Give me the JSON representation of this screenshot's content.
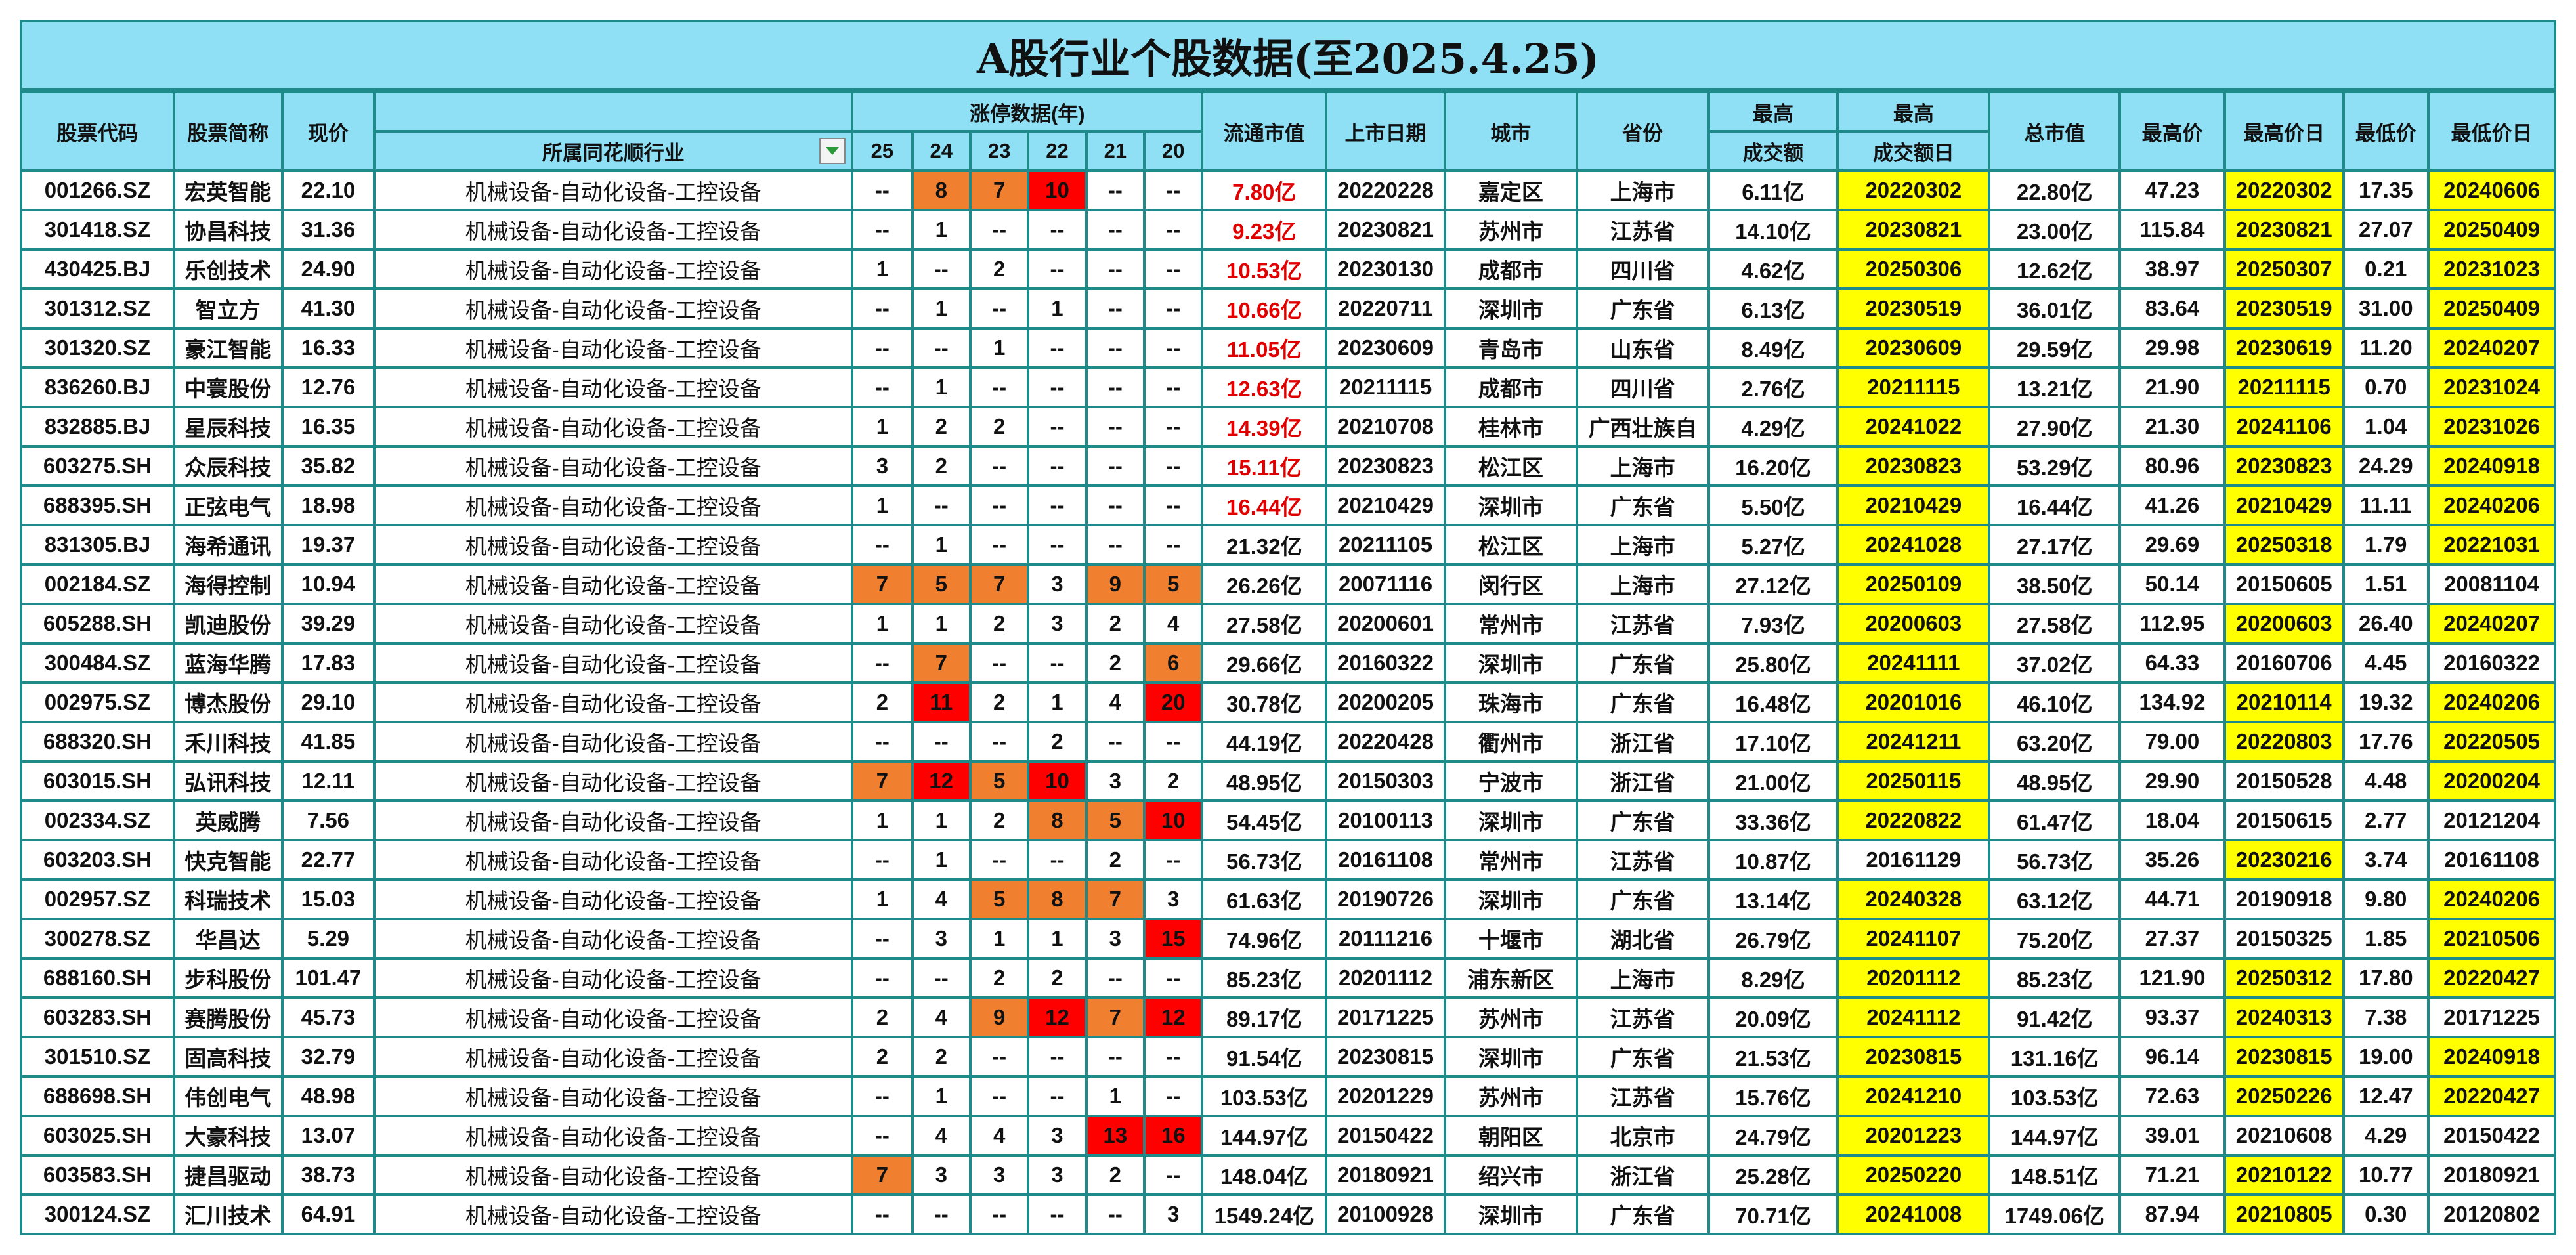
{
  "title": "A股行业个股数据(至2025.4.25)",
  "headers": {
    "code": "股票代码",
    "name": "股票简称",
    "price": "现价",
    "industry": "所属同花顺行业",
    "limit_group": "涨停数据(年)",
    "years": [
      "25",
      "24",
      "23",
      "22",
      "21",
      "20"
    ],
    "float_cap": "流通市值",
    "list_date": "上市日期",
    "city": "城市",
    "province": "省份",
    "max_turnover_top": "最高",
    "max_turnover_bottom": "成交额",
    "max_turnover_day_top": "最高",
    "max_turnover_day_bottom": "成交额日",
    "total_cap": "总市值",
    "high_price": "最高价",
    "high_day": "最高价日",
    "low_price": "最低价",
    "low_day": "最低价日"
  },
  "colors": {
    "header_bg": "#8fe0f5",
    "border": "#1f8a8a",
    "highlight_yellow": "#ffff00",
    "limit_orange": "#f08030",
    "limit_red": "#ff0000",
    "value_red": "#e00000"
  },
  "icons": {
    "filter": "dropdown-filter-icon"
  },
  "rows": [
    {
      "code": "001266.SZ",
      "name": "宏英智能",
      "price": "22.10",
      "industry": "机械设备-自动化设备-工控设备",
      "limits": [
        "--",
        "8",
        "7",
        "10",
        "--",
        "--"
      ],
      "float_cap": "7.80亿",
      "list_date": "20220228",
      "city": "嘉定区",
      "province": "上海市",
      "max_turnover": "6.11亿",
      "max_turnover_day": "20220302",
      "total_cap": "22.80亿",
      "high_price": "47.23",
      "high_day": "20220302",
      "low_price": "17.35",
      "low_day": "20240606"
    },
    {
      "code": "301418.SZ",
      "name": "协昌科技",
      "price": "31.36",
      "industry": "机械设备-自动化设备-工控设备",
      "limits": [
        "--",
        "1",
        "--",
        "--",
        "--",
        "--"
      ],
      "float_cap": "9.23亿",
      "list_date": "20230821",
      "city": "苏州市",
      "province": "江苏省",
      "max_turnover": "14.10亿",
      "max_turnover_day": "20230821",
      "total_cap": "23.00亿",
      "high_price": "115.84",
      "high_day": "20230821",
      "low_price": "27.07",
      "low_day": "20250409"
    },
    {
      "code": "430425.BJ",
      "name": "乐创技术",
      "price": "24.90",
      "industry": "机械设备-自动化设备-工控设备",
      "limits": [
        "1",
        "--",
        "2",
        "--",
        "--",
        "--"
      ],
      "float_cap": "10.53亿",
      "list_date": "20230130",
      "city": "成都市",
      "province": "四川省",
      "max_turnover": "4.62亿",
      "max_turnover_day": "20250306",
      "total_cap": "12.62亿",
      "high_price": "38.97",
      "high_day": "20250307",
      "low_price": "0.21",
      "low_day": "20231023"
    },
    {
      "code": "301312.SZ",
      "name": "智立方",
      "price": "41.30",
      "industry": "机械设备-自动化设备-工控设备",
      "limits": [
        "--",
        "1",
        "--",
        "1",
        "--",
        "--"
      ],
      "float_cap": "10.66亿",
      "list_date": "20220711",
      "city": "深圳市",
      "province": "广东省",
      "max_turnover": "6.13亿",
      "max_turnover_day": "20230519",
      "total_cap": "36.01亿",
      "high_price": "83.64",
      "high_day": "20230519",
      "low_price": "31.00",
      "low_day": "20250409"
    },
    {
      "code": "301320.SZ",
      "name": "豪江智能",
      "price": "16.33",
      "industry": "机械设备-自动化设备-工控设备",
      "limits": [
        "--",
        "--",
        "1",
        "--",
        "--",
        "--"
      ],
      "float_cap": "11.05亿",
      "list_date": "20230609",
      "city": "青岛市",
      "province": "山东省",
      "max_turnover": "8.49亿",
      "max_turnover_day": "20230609",
      "total_cap": "29.59亿",
      "high_price": "29.98",
      "high_day": "20230619",
      "low_price": "11.20",
      "low_day": "20240207"
    },
    {
      "code": "836260.BJ",
      "name": "中寰股份",
      "price": "12.76",
      "industry": "机械设备-自动化设备-工控设备",
      "limits": [
        "--",
        "1",
        "--",
        "--",
        "--",
        "--"
      ],
      "float_cap": "12.63亿",
      "list_date": "20211115",
      "city": "成都市",
      "province": "四川省",
      "max_turnover": "2.76亿",
      "max_turnover_day": "20211115",
      "total_cap": "13.21亿",
      "high_price": "21.90",
      "high_day": "20211115",
      "low_price": "0.70",
      "low_day": "20231024"
    },
    {
      "code": "832885.BJ",
      "name": "星辰科技",
      "price": "16.35",
      "industry": "机械设备-自动化设备-工控设备",
      "limits": [
        "1",
        "2",
        "2",
        "--",
        "--",
        "--"
      ],
      "float_cap": "14.39亿",
      "list_date": "20210708",
      "city": "桂林市",
      "province": "广西壮族自",
      "max_turnover": "4.29亿",
      "max_turnover_day": "20241022",
      "total_cap": "27.90亿",
      "high_price": "21.30",
      "high_day": "20241106",
      "low_price": "1.04",
      "low_day": "20231026"
    },
    {
      "code": "603275.SH",
      "name": "众辰科技",
      "price": "35.82",
      "industry": "机械设备-自动化设备-工控设备",
      "limits": [
        "3",
        "2",
        "--",
        "--",
        "--",
        "--"
      ],
      "float_cap": "15.11亿",
      "list_date": "20230823",
      "city": "松江区",
      "province": "上海市",
      "max_turnover": "16.20亿",
      "max_turnover_day": "20230823",
      "total_cap": "53.29亿",
      "high_price": "80.96",
      "high_day": "20230823",
      "low_price": "24.29",
      "low_day": "20240918"
    },
    {
      "code": "688395.SH",
      "name": "正弦电气",
      "price": "18.98",
      "industry": "机械设备-自动化设备-工控设备",
      "limits": [
        "1",
        "--",
        "--",
        "--",
        "--",
        "--"
      ],
      "float_cap": "16.44亿",
      "list_date": "20210429",
      "city": "深圳市",
      "province": "广东省",
      "max_turnover": "5.50亿",
      "max_turnover_day": "20210429",
      "total_cap": "16.44亿",
      "high_price": "41.26",
      "high_day": "20210429",
      "low_price": "11.11",
      "low_day": "20240206"
    },
    {
      "code": "831305.BJ",
      "name": "海希通讯",
      "price": "19.37",
      "industry": "机械设备-自动化设备-工控设备",
      "limits": [
        "--",
        "1",
        "--",
        "--",
        "--",
        "--"
      ],
      "float_cap": "21.32亿",
      "list_date": "20211105",
      "city": "松江区",
      "province": "上海市",
      "max_turnover": "5.27亿",
      "max_turnover_day": "20241028",
      "total_cap": "27.17亿",
      "high_price": "29.69",
      "high_day": "20250318",
      "low_price": "1.79",
      "low_day": "20221031"
    },
    {
      "code": "002184.SZ",
      "name": "海得控制",
      "price": "10.94",
      "industry": "机械设备-自动化设备-工控设备",
      "limits": [
        "7",
        "5",
        "7",
        "3",
        "9",
        "5"
      ],
      "float_cap": "26.26亿",
      "list_date": "20071116",
      "city": "闵行区",
      "province": "上海市",
      "max_turnover": "27.12亿",
      "max_turnover_day": "20250109",
      "total_cap": "38.50亿",
      "high_price": "50.14",
      "high_day": "20150605",
      "low_price": "1.51",
      "low_day": "20081104"
    },
    {
      "code": "605288.SH",
      "name": "凯迪股份",
      "price": "39.29",
      "industry": "机械设备-自动化设备-工控设备",
      "limits": [
        "1",
        "1",
        "2",
        "3",
        "2",
        "4"
      ],
      "float_cap": "27.58亿",
      "list_date": "20200601",
      "city": "常州市",
      "province": "江苏省",
      "max_turnover": "7.93亿",
      "max_turnover_day": "20200603",
      "total_cap": "27.58亿",
      "high_price": "112.95",
      "high_day": "20200603",
      "low_price": "26.40",
      "low_day": "20240207"
    },
    {
      "code": "300484.SZ",
      "name": "蓝海华腾",
      "price": "17.83",
      "industry": "机械设备-自动化设备-工控设备",
      "limits": [
        "--",
        "7",
        "--",
        "--",
        "2",
        "6"
      ],
      "float_cap": "29.66亿",
      "list_date": "20160322",
      "city": "深圳市",
      "province": "广东省",
      "max_turnover": "25.80亿",
      "max_turnover_day": "20241111",
      "total_cap": "37.02亿",
      "high_price": "64.33",
      "high_day": "20160706",
      "low_price": "4.45",
      "low_day": "20160322"
    },
    {
      "code": "002975.SZ",
      "name": "博杰股份",
      "price": "29.10",
      "industry": "机械设备-自动化设备-工控设备",
      "limits": [
        "2",
        "11",
        "2",
        "1",
        "4",
        "20"
      ],
      "float_cap": "30.78亿",
      "list_date": "20200205",
      "city": "珠海市",
      "province": "广东省",
      "max_turnover": "16.48亿",
      "max_turnover_day": "20201016",
      "total_cap": "46.10亿",
      "high_price": "134.92",
      "high_day": "20210114",
      "low_price": "19.32",
      "low_day": "20240206"
    },
    {
      "code": "688320.SH",
      "name": "禾川科技",
      "price": "41.85",
      "industry": "机械设备-自动化设备-工控设备",
      "limits": [
        "--",
        "--",
        "--",
        "2",
        "--",
        "--"
      ],
      "float_cap": "44.19亿",
      "list_date": "20220428",
      "city": "衢州市",
      "province": "浙江省",
      "max_turnover": "17.10亿",
      "max_turnover_day": "20241211",
      "total_cap": "63.20亿",
      "high_price": "79.00",
      "high_day": "20220803",
      "low_price": "17.76",
      "low_day": "20220505"
    },
    {
      "code": "603015.SH",
      "name": "弘讯科技",
      "price": "12.11",
      "industry": "机械设备-自动化设备-工控设备",
      "limits": [
        "7",
        "12",
        "5",
        "10",
        "3",
        "2"
      ],
      "float_cap": "48.95亿",
      "list_date": "20150303",
      "city": "宁波市",
      "province": "浙江省",
      "max_turnover": "21.00亿",
      "max_turnover_day": "20250115",
      "total_cap": "48.95亿",
      "high_price": "29.90",
      "high_day": "20150528",
      "low_price": "4.48",
      "low_day": "20200204"
    },
    {
      "code": "002334.SZ",
      "name": "英威腾",
      "price": "7.56",
      "industry": "机械设备-自动化设备-工控设备",
      "limits": [
        "1",
        "1",
        "2",
        "8",
        "5",
        "10"
      ],
      "float_cap": "54.45亿",
      "list_date": "20100113",
      "city": "深圳市",
      "province": "广东省",
      "max_turnover": "33.36亿",
      "max_turnover_day": "20220822",
      "total_cap": "61.47亿",
      "high_price": "18.04",
      "high_day": "20150615",
      "low_price": "2.77",
      "low_day": "20121204"
    },
    {
      "code": "603203.SH",
      "name": "快克智能",
      "price": "22.77",
      "industry": "机械设备-自动化设备-工控设备",
      "limits": [
        "--",
        "1",
        "--",
        "--",
        "2",
        "--"
      ],
      "float_cap": "56.73亿",
      "list_date": "20161108",
      "city": "常州市",
      "province": "江苏省",
      "max_turnover": "10.87亿",
      "max_turnover_day": "20161129",
      "total_cap": "56.73亿",
      "high_price": "35.26",
      "high_day": "20230216",
      "low_price": "3.74",
      "low_day": "20161108"
    },
    {
      "code": "002957.SZ",
      "name": "科瑞技术",
      "price": "15.03",
      "industry": "机械设备-自动化设备-工控设备",
      "limits": [
        "1",
        "4",
        "5",
        "8",
        "7",
        "3"
      ],
      "float_cap": "61.63亿",
      "list_date": "20190726",
      "city": "深圳市",
      "province": "广东省",
      "max_turnover": "13.14亿",
      "max_turnover_day": "20240328",
      "total_cap": "63.12亿",
      "high_price": "44.71",
      "high_day": "20190918",
      "low_price": "9.80",
      "low_day": "20240206"
    },
    {
      "code": "300278.SZ",
      "name": "华昌达",
      "price": "5.29",
      "industry": "机械设备-自动化设备-工控设备",
      "limits": [
        "--",
        "3",
        "1",
        "1",
        "3",
        "15"
      ],
      "float_cap": "74.96亿",
      "list_date": "20111216",
      "city": "十堰市",
      "province": "湖北省",
      "max_turnover": "26.79亿",
      "max_turnover_day": "20241107",
      "total_cap": "75.20亿",
      "high_price": "27.37",
      "high_day": "20150325",
      "low_price": "1.85",
      "low_day": "20210506"
    },
    {
      "code": "688160.SH",
      "name": "步科股份",
      "price": "101.47",
      "industry": "机械设备-自动化设备-工控设备",
      "limits": [
        "--",
        "--",
        "2",
        "2",
        "--",
        "--"
      ],
      "float_cap": "85.23亿",
      "list_date": "20201112",
      "city": "浦东新区",
      "province": "上海市",
      "max_turnover": "8.29亿",
      "max_turnover_day": "20201112",
      "total_cap": "85.23亿",
      "high_price": "121.90",
      "high_day": "20250312",
      "low_price": "17.80",
      "low_day": "20220427"
    },
    {
      "code": "603283.SH",
      "name": "赛腾股份",
      "price": "45.73",
      "industry": "机械设备-自动化设备-工控设备",
      "limits": [
        "2",
        "4",
        "9",
        "12",
        "7",
        "12"
      ],
      "float_cap": "89.17亿",
      "list_date": "20171225",
      "city": "苏州市",
      "province": "江苏省",
      "max_turnover": "20.09亿",
      "max_turnover_day": "20241112",
      "total_cap": "91.42亿",
      "high_price": "93.37",
      "high_day": "20240313",
      "low_price": "7.38",
      "low_day": "20171225"
    },
    {
      "code": "301510.SZ",
      "name": "固高科技",
      "price": "32.79",
      "industry": "机械设备-自动化设备-工控设备",
      "limits": [
        "2",
        "2",
        "--",
        "--",
        "--",
        "--"
      ],
      "float_cap": "91.54亿",
      "list_date": "20230815",
      "city": "深圳市",
      "province": "广东省",
      "max_turnover": "21.53亿",
      "max_turnover_day": "20230815",
      "total_cap": "131.16亿",
      "high_price": "96.14",
      "high_day": "20230815",
      "low_price": "19.00",
      "low_day": "20240918"
    },
    {
      "code": "688698.SH",
      "name": "伟创电气",
      "price": "48.98",
      "industry": "机械设备-自动化设备-工控设备",
      "limits": [
        "--",
        "1",
        "--",
        "--",
        "1",
        "--"
      ],
      "float_cap": "103.53亿",
      "list_date": "20201229",
      "city": "苏州市",
      "province": "江苏省",
      "max_turnover": "15.76亿",
      "max_turnover_day": "20241210",
      "total_cap": "103.53亿",
      "high_price": "72.63",
      "high_day": "20250226",
      "low_price": "12.47",
      "low_day": "20220427"
    },
    {
      "code": "603025.SH",
      "name": "大豪科技",
      "price": "13.07",
      "industry": "机械设备-自动化设备-工控设备",
      "limits": [
        "--",
        "4",
        "4",
        "3",
        "13",
        "16"
      ],
      "float_cap": "144.97亿",
      "list_date": "20150422",
      "city": "朝阳区",
      "province": "北京市",
      "max_turnover": "24.79亿",
      "max_turnover_day": "20201223",
      "total_cap": "144.97亿",
      "high_price": "39.01",
      "high_day": "20210608",
      "low_price": "4.29",
      "low_day": "20150422"
    },
    {
      "code": "603583.SH",
      "name": "捷昌驱动",
      "price": "38.73",
      "industry": "机械设备-自动化设备-工控设备",
      "limits": [
        "7",
        "3",
        "3",
        "3",
        "2",
        "--"
      ],
      "float_cap": "148.04亿",
      "list_date": "20180921",
      "city": "绍兴市",
      "province": "浙江省",
      "max_turnover": "25.28亿",
      "max_turnover_day": "20250220",
      "total_cap": "148.51亿",
      "high_price": "71.21",
      "high_day": "20210122",
      "low_price": "10.77",
      "low_day": "20180921"
    },
    {
      "code": "300124.SZ",
      "name": "汇川技术",
      "price": "64.91",
      "industry": "机械设备-自动化设备-工控设备",
      "limits": [
        "--",
        "--",
        "--",
        "--",
        "--",
        "3"
      ],
      "float_cap": "1549.24亿",
      "list_date": "20100928",
      "city": "深圳市",
      "province": "广东省",
      "max_turnover": "70.71亿",
      "max_turnover_day": "20241008",
      "total_cap": "1749.06亿",
      "high_price": "87.94",
      "high_day": "20210805",
      "low_price": "0.30",
      "low_day": "20120802"
    }
  ]
}
